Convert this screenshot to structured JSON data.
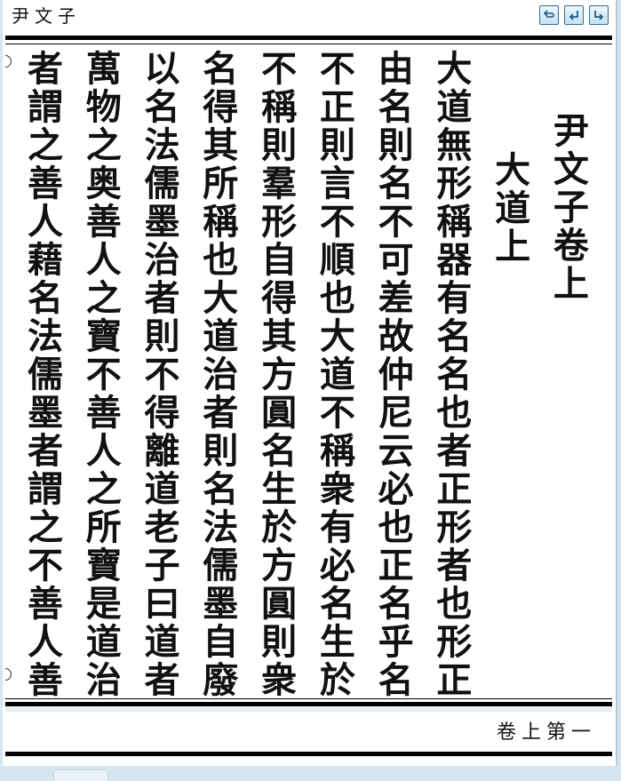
{
  "header": {
    "running_title": "尹文子"
  },
  "nav": {
    "buttons": [
      {
        "name": "back-icon"
      },
      {
        "name": "prev-page-icon"
      },
      {
        "name": "next-page-icon"
      }
    ]
  },
  "page": {
    "columns": [
      "尹文子卷上",
      "大道上",
      "大道無形稱器有名名也者正形者也形正",
      "由名則名不可差故仲尼云必也正名乎名",
      "不正則言不順也大道不稱衆有必名生於",
      "不稱則羣形自得其方圓名生於方圓則衆",
      "名得其所稱也大道治者則名法儒墨自廢",
      "以名法儒墨治者則不得離道老子曰道者",
      "萬物之奥善人之寶不善人之所寶是道治",
      "者謂之善人藉名法儒墨者謂之不善人善"
    ]
  },
  "footer": {
    "page_label": "卷上第一"
  },
  "colors": {
    "background": "#d6e6ee",
    "paper": "#ffffff",
    "ink": "#111111",
    "nav_border": "#2e6f99"
  }
}
